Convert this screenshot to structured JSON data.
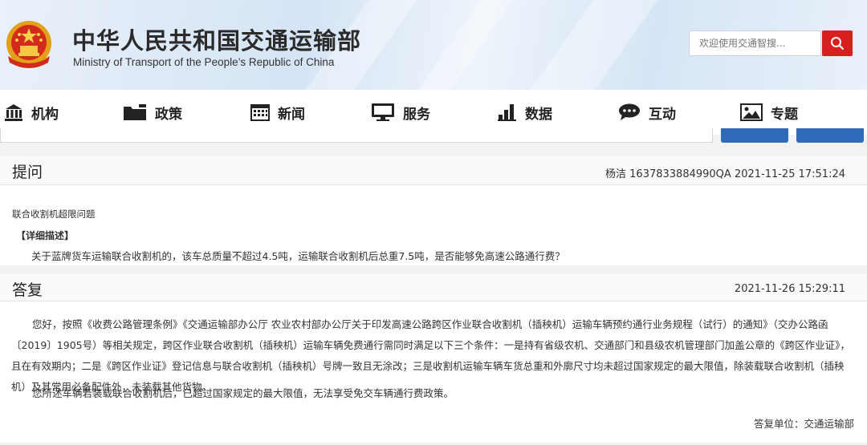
{
  "header": {
    "title_cn": "中华人民共和国交通运输部",
    "title_en": "Ministry of Transport of the People’s Republic of China",
    "search_placeholder": "欢迎使用交通智搜...",
    "search_icon": "search-icon",
    "brand_red": "#d81e1e"
  },
  "nav": {
    "items": [
      {
        "label": "机构",
        "icon": "building-icon"
      },
      {
        "label": "政策",
        "icon": "folder-icon"
      },
      {
        "label": "新闻",
        "icon": "calendar-icon"
      },
      {
        "label": "服务",
        "icon": "monitor-icon"
      },
      {
        "label": "数据",
        "icon": "bar-chart-icon"
      },
      {
        "label": "互动",
        "icon": "chat-icon"
      },
      {
        "label": "专题",
        "icon": "image-icon"
      }
    ]
  },
  "question": {
    "header_label": "提问",
    "meta": "杨洁 1637833884990QA   2021-11-25 17:51:24",
    "title": "联合收割机超限问题",
    "detail_label": "【详细描述】",
    "body": "关于蓝牌货车运输联合收割机的，该车总质量不超过4.5吨，运输联合收割机后总重7.5吨，是否能够免高速公路通行费？"
  },
  "answer": {
    "header_label": "答复",
    "meta": "2021-11-26 15:29:11",
    "paragraph1": "您好，按照《收费公路管理条例》《交通运输部办公厅 农业农村部办公厅关于印发高速公路跨区作业联合收割机（插秧机）运输车辆预约通行业务规程（试行）的通知》（交办公路函〔2019〕1905号）等相关规定，跨区作业联合收割机（插秧机）运输车辆免费通行需同时满足以下三个条件：一是持有省级农机、交通部门和县级农机管理部门加盖公章的《跨区作业证》，且在有效期内；二是《跨区作业证》登记信息与联合收割机（插秧机）号牌一致且无涂改；三是收割机运输车辆车货总重和外廓尺寸均未超过国家规定的最大限值，除装载联合收割机（插秧机）及其常用必备配件外，未装载其他货物。",
    "paragraph2": "您所述车辆若装载联合收割机后，已超过国家规定的最大限值，无法享受免交车辆通行费政策。",
    "footer": "答复单位：交通运输部"
  }
}
